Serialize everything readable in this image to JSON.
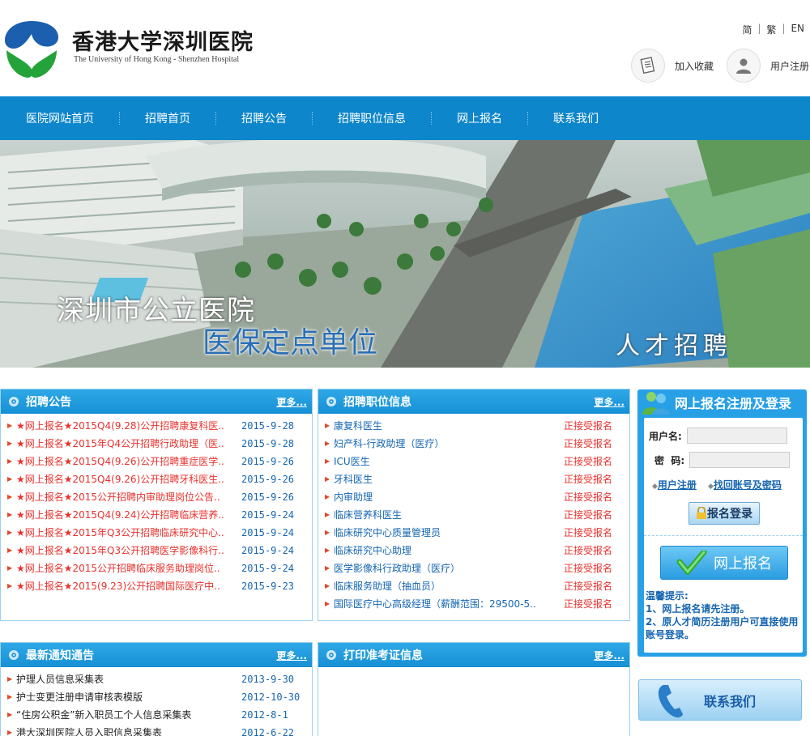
{
  "header": {
    "brand_cn": "香港大学深圳医院",
    "brand_en": "The University of Hong Kong - Shenzhen Hospital",
    "lang": [
      "简",
      "繁",
      "EN"
    ],
    "bookmark_label": "加入收藏",
    "register_label": "用户注册"
  },
  "nav": {
    "items": [
      "医院网站首页",
      "招聘首页",
      "招聘公告",
      "招聘职位信息",
      "网上报名",
      "联系我们"
    ]
  },
  "banner": {
    "line1": "深圳市公立医院",
    "line2": "医保定点单位",
    "line3": "人才招聘"
  },
  "announcements": {
    "title": "招聘公告",
    "more": "更多...",
    "items": [
      {
        "text": "★网上报名★2015Q4(9.28)公开招聘康复科医..",
        "date": "2015-9-28"
      },
      {
        "text": "★网上报名★2015年Q4公开招聘行政助理（医..",
        "date": "2015-9-28"
      },
      {
        "text": "★网上报名★2015Q4(9.26)公开招聘重症医学..",
        "date": "2015-9-26"
      },
      {
        "text": "★网上报名★2015Q4(9.26)公开招聘牙科医生..",
        "date": "2015-9-26"
      },
      {
        "text": "★网上报名★2015公开招聘内审助理岗位公告..",
        "date": "2015-9-26"
      },
      {
        "text": "★网上报名★2015Q4(9.24)公开招聘临床营养..",
        "date": "2015-9-24"
      },
      {
        "text": "★网上报名★2015年Q3公开招聘临床研究中心..",
        "date": "2015-9-24"
      },
      {
        "text": "★网上报名★2015年Q3公开招聘医学影像科行..",
        "date": "2015-9-24"
      },
      {
        "text": "★网上报名★2015公开招聘临床服务助理岗位..",
        "date": "2015-9-24"
      },
      {
        "text": "★网上报名★2015(9.23)公开招聘国际医疗中..",
        "date": "2015-9-23"
      }
    ]
  },
  "positions": {
    "title": "招聘职位信息",
    "more": "更多...",
    "items": [
      {
        "text": "康复科医生",
        "status": "正接受报名"
      },
      {
        "text": "妇产科-行政助理（医疗）",
        "status": "正接受报名"
      },
      {
        "text": "ICU医生",
        "status": "正接受报名"
      },
      {
        "text": "牙科医生",
        "status": "正接受报名"
      },
      {
        "text": "内审助理",
        "status": "正接受报名"
      },
      {
        "text": "临床营养科医生",
        "status": "正接受报名"
      },
      {
        "text": "临床研究中心质量管理员",
        "status": "正接受报名"
      },
      {
        "text": "临床研究中心助理",
        "status": "正接受报名"
      },
      {
        "text": "医学影像科行政助理（医疗）",
        "status": "正接受报名"
      },
      {
        "text": "临床服务助理（抽血员）",
        "status": "正接受报名"
      },
      {
        "text": "国际医疗中心高级经理（薪酬范围：29500-5..",
        "status": "正接受报名"
      }
    ]
  },
  "notices": {
    "title": "最新通知通告",
    "more": "更多...",
    "items": [
      {
        "text": "护理人员信息采集表",
        "date": "2013-9-30"
      },
      {
        "text": "护士变更注册申请审核表模版",
        "date": "2012-10-30"
      },
      {
        "text": "“住房公积金”新入职员工个人信息采集表",
        "date": "2012-8-1"
      },
      {
        "text": "港大深圳医院人员入职信息采集表",
        "date": "2012-6-22"
      }
    ]
  },
  "admission": {
    "title": "打印准考证信息",
    "more": "更多..."
  },
  "login": {
    "title": "网上报名注册及登录",
    "username_label": "用户名:",
    "password_label": "密  码:",
    "register_link": "用户注册",
    "recover_link": "找回账号及密码",
    "login_button": "报名登录",
    "online_button": "网上报名",
    "tips_title": "温馨提示:",
    "tip1": "1、网上报名请先注册。",
    "tip2": "2、原人才简历注册用户可直接使用账号登录。"
  },
  "contact": {
    "label": "联系我们"
  },
  "colors": {
    "nav_blue": "#0e86cb",
    "panel_blue": "#1690d4",
    "alert_red": "#e8322e",
    "link_blue": "#1565b0"
  }
}
